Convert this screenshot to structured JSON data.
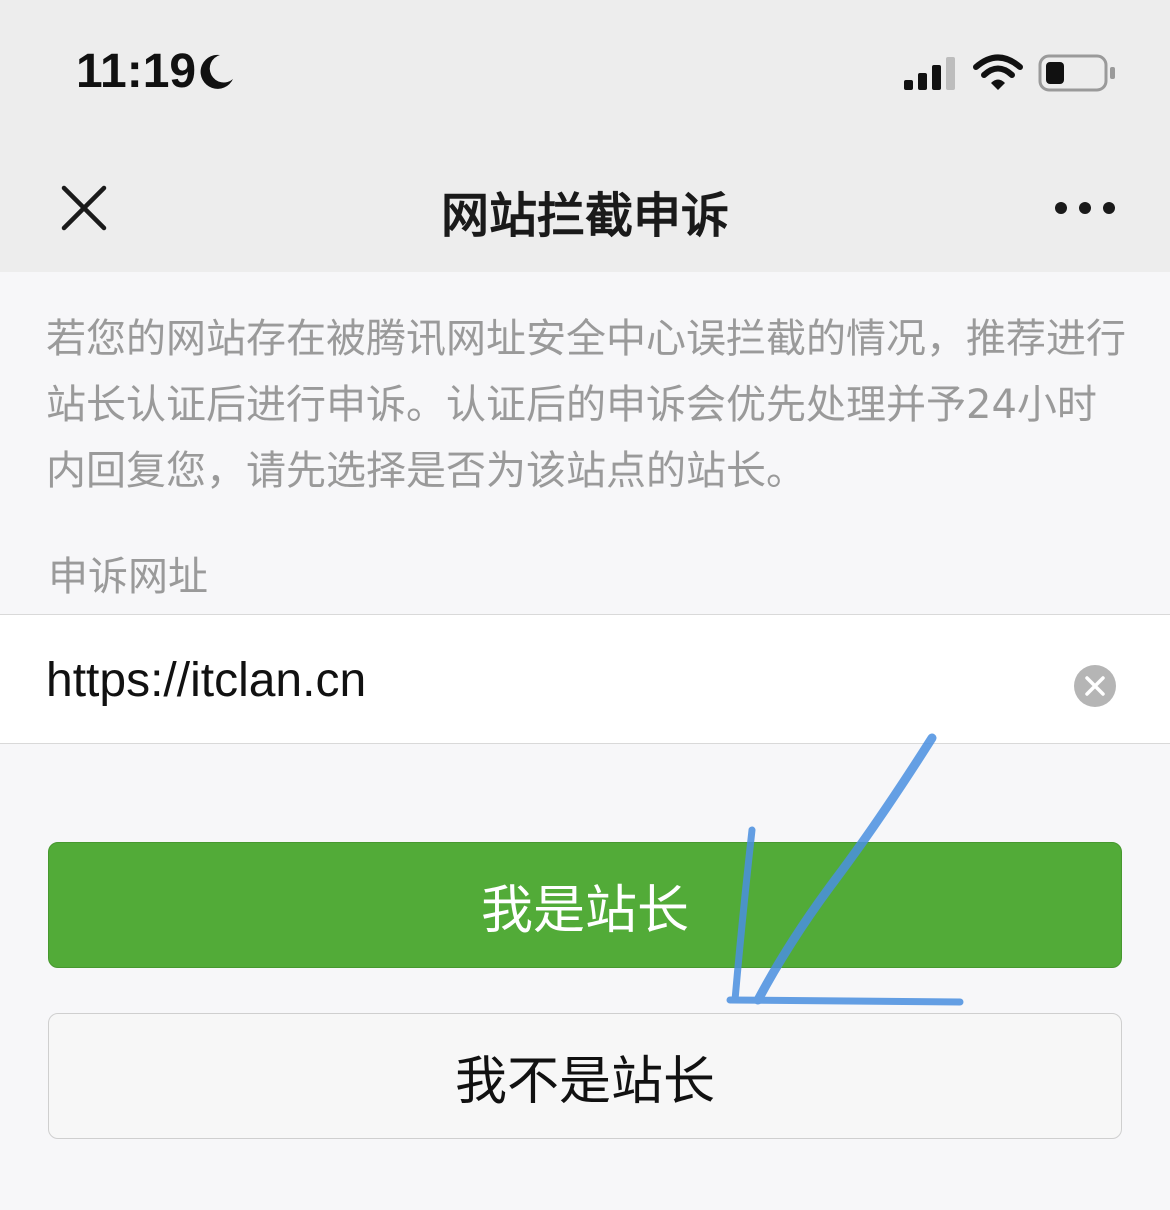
{
  "status_bar": {
    "time": "11:19",
    "icons": [
      "moon-icon",
      "signal-icon",
      "wifi-icon",
      "battery-icon"
    ]
  },
  "nav": {
    "title": "网站拦截申诉",
    "close_icon": "close-icon",
    "more_icon": "more-icon"
  },
  "intro_text": "若您的网站存在被腾讯网址安全中心误拦截的情况，推荐进行站长认证后进行申诉。认证后的申诉会优先处理并予24小时内回复您，请先选择是否为该站点的站长。",
  "form": {
    "label": "申诉网址",
    "url_value": "https://itclan.cn",
    "clear_icon": "clear-icon"
  },
  "buttons": {
    "primary": "我是站长",
    "secondary": "我不是站长"
  },
  "colors": {
    "primary_green": "#52ab38",
    "nav_background": "#ededed",
    "page_background": "#f7f7f9",
    "annotation_blue": "#4a8fe0"
  }
}
